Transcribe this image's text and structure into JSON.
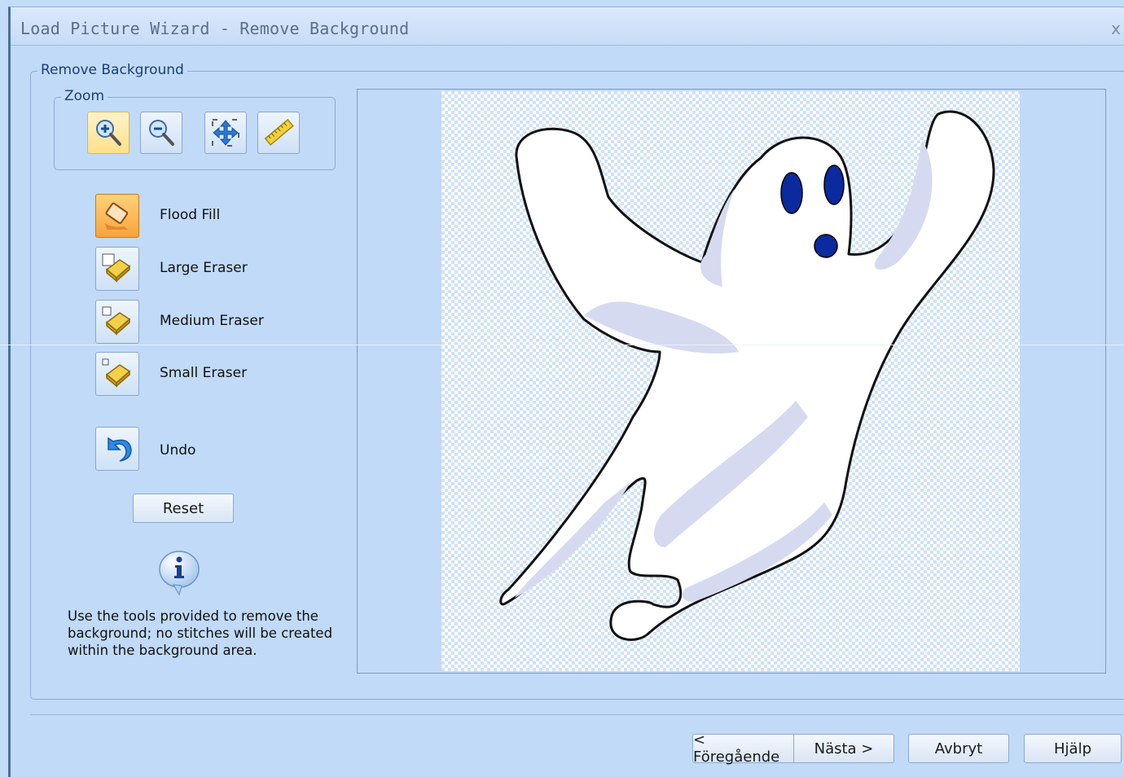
{
  "window": {
    "title": "Load Picture Wizard - Remove Background",
    "close_label": "x"
  },
  "remove_group": {
    "legend": "Remove Background"
  },
  "zoom_group": {
    "legend": "Zoom",
    "buttons": [
      {
        "name": "zoom-in",
        "icon": "zoom-in-icon"
      },
      {
        "name": "zoom-out",
        "icon": "zoom-out-icon"
      },
      {
        "name": "pan",
        "icon": "move-arrows-icon"
      },
      {
        "name": "fit",
        "icon": "ruler-icon"
      }
    ]
  },
  "tools": [
    {
      "label": "Flood Fill",
      "icon": "flood-fill-icon",
      "active": true
    },
    {
      "label": "Large Eraser",
      "icon": "large-eraser-icon",
      "active": false
    },
    {
      "label": "Medium Eraser",
      "icon": "medium-eraser-icon",
      "active": false
    },
    {
      "label": "Small Eraser",
      "icon": "small-eraser-icon",
      "active": false
    },
    {
      "label": "Undo",
      "icon": "undo-icon",
      "active": false
    }
  ],
  "reset_label": "Reset",
  "info": {
    "icon": "info-icon",
    "text": "Use the tools provided to remove the background; no stitches will be created within the background area."
  },
  "footer": {
    "prev_label": "< Föregående",
    "next_label": "Nästa >",
    "cancel_label": "Avbryt",
    "help_label": "Hjälp"
  },
  "colors": {
    "window_bg": "#c1daf7",
    "accent_active": "#f8a43a",
    "ghost_fill": "#ffffff",
    "ghost_shadow": "#d6daf0",
    "eye_color": "#0a2a9e"
  }
}
